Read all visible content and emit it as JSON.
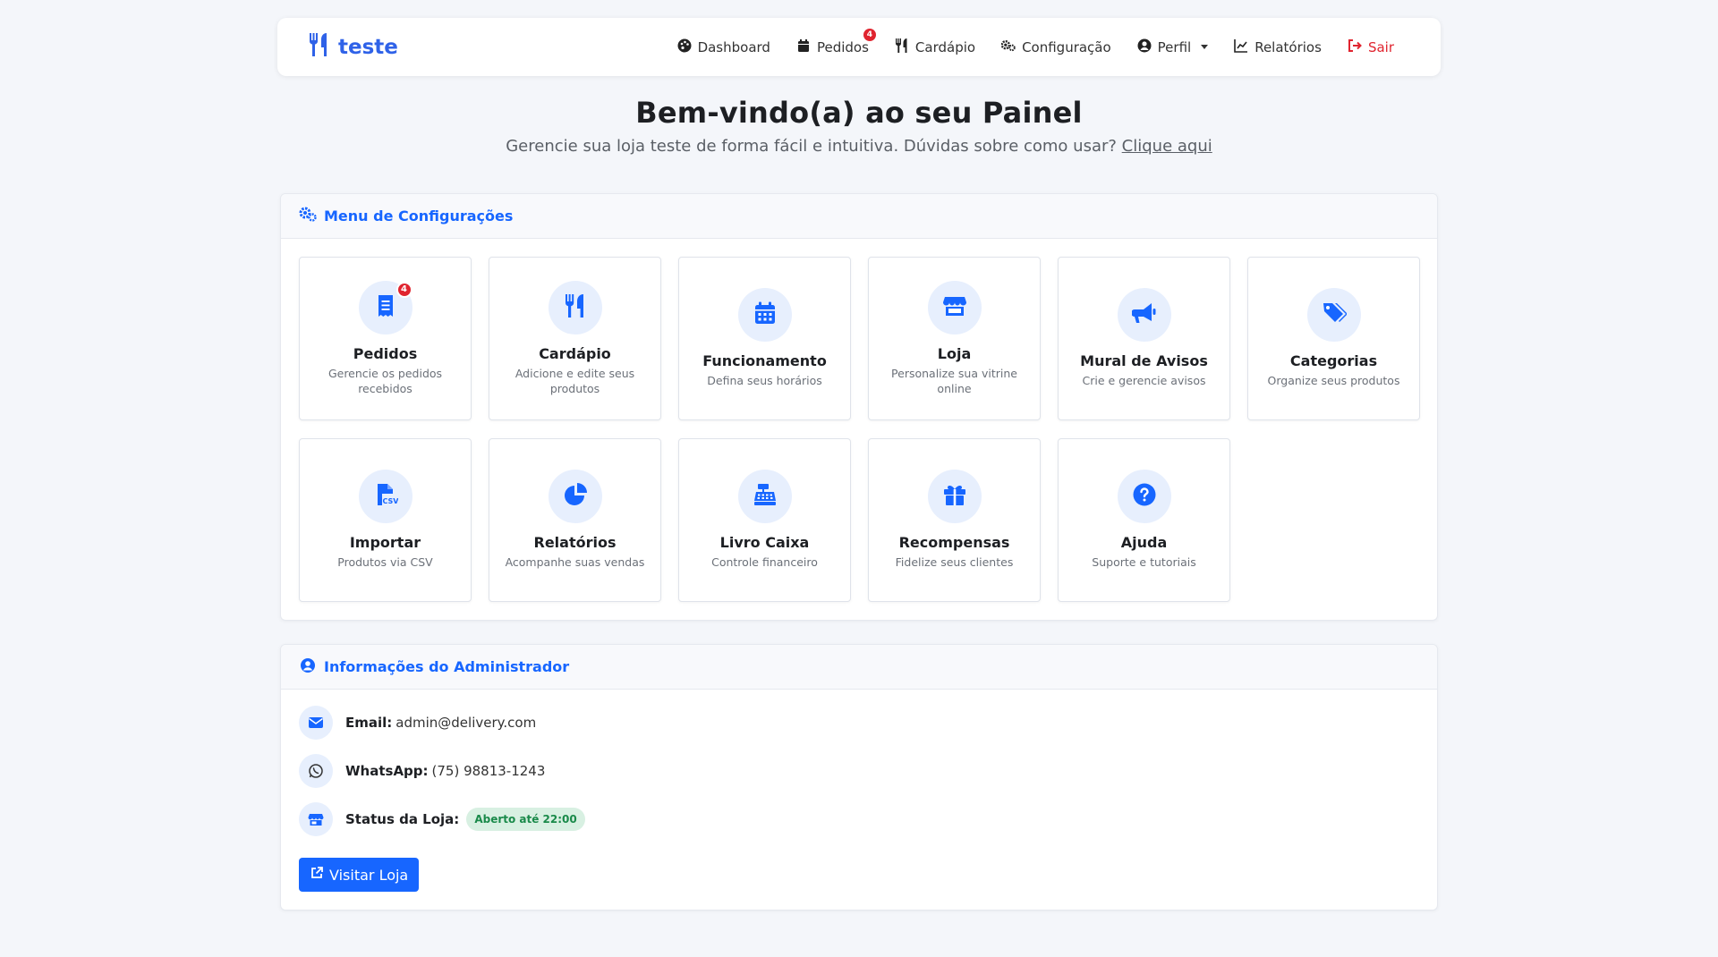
{
  "brand": {
    "name": "teste",
    "icon": "utensils-icon"
  },
  "nav": {
    "items": [
      {
        "label": "Dashboard",
        "icon": "palette-icon"
      },
      {
        "label": "Pedidos",
        "icon": "calendar-icon",
        "badge": "4"
      },
      {
        "label": "Cardápio",
        "icon": "utensils-icon"
      },
      {
        "label": "Configuração",
        "icon": "gears-icon"
      },
      {
        "label": "Perfil",
        "icon": "user-circle-icon",
        "dropdown": true
      },
      {
        "label": "Relatórios",
        "icon": "chart-line-icon"
      },
      {
        "label": "Sair",
        "icon": "sign-out-icon"
      }
    ]
  },
  "hero": {
    "title": "Bem-vindo(a) ao seu Painel",
    "subtitle": "Gerencie sua loja teste de forma fácil e intuitiva. Dúvidas sobre como usar?",
    "link": "Clique aqui"
  },
  "config": {
    "header": "Menu de Configurações",
    "tiles": [
      {
        "title": "Pedidos",
        "desc": "Gerencie os pedidos recebidos",
        "icon": "receipt-icon",
        "badge": "4"
      },
      {
        "title": "Cardápio",
        "desc": "Adicione e edite seus produtos",
        "icon": "utensils-icon"
      },
      {
        "title": "Funcionamento",
        "desc": "Defina seus horários",
        "icon": "calendar-icon"
      },
      {
        "title": "Loja",
        "desc": "Personalize sua vitrine online",
        "icon": "store-icon"
      },
      {
        "title": "Mural de Avisos",
        "desc": "Crie e gerencie avisos",
        "icon": "megaphone-icon"
      },
      {
        "title": "Categorias",
        "desc": "Organize seus produtos",
        "icon": "tags-icon"
      },
      {
        "title": "Importar",
        "desc": "Produtos via CSV",
        "icon": "file-csv-icon"
      },
      {
        "title": "Relatórios",
        "desc": "Acompanhe suas vendas",
        "icon": "chart-pie-icon"
      },
      {
        "title": "Livro Caixa",
        "desc": "Controle financeiro",
        "icon": "cash-register-icon"
      },
      {
        "title": "Recompensas",
        "desc": "Fidelize seus clientes",
        "icon": "gift-icon"
      },
      {
        "title": "Ajuda",
        "desc": "Suporte e tutoriais",
        "icon": "question-circle-icon"
      }
    ]
  },
  "admin": {
    "header": "Informações do Administrador",
    "email_label": "Email:",
    "email": "admin@delivery.com",
    "whatsapp_label": "WhatsApp:",
    "whatsapp": "(75) 98813-1243",
    "status_label": "Status da Loja:",
    "status": "Aberto até 22:00",
    "visit_button": "Visitar Loja"
  },
  "colors": {
    "primary": "#1766ff",
    "brand": "#2f62e8",
    "danger": "#e0242f",
    "success_bg": "#d8f0e2",
    "success_text": "#1a8a4a",
    "icon_bg": "#e7effd"
  }
}
